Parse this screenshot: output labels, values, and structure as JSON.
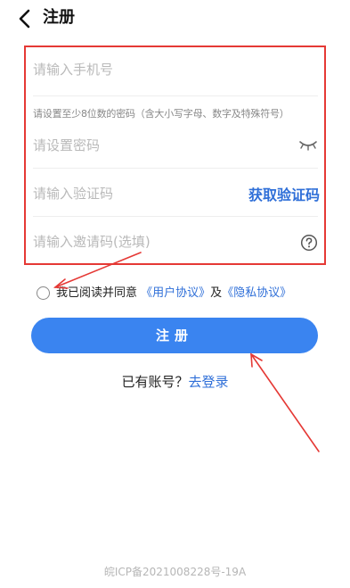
{
  "header": {
    "title": "注册",
    "back_icon": "chevron-left-icon"
  },
  "form": {
    "phone_placeholder": "请输入手机号",
    "password_hint": "请设置至少8位数的密码（含大小写字母、数字及特殊符号）",
    "password_placeholder": "请设置密码",
    "password_eye_icon": "eye-closed-icon",
    "code_placeholder": "请输入验证码",
    "get_code_label": "获取验证码",
    "invite_placeholder": "请输入邀请码(选填)",
    "invite_help_icon": "question-circle-icon"
  },
  "agreement": {
    "text": "我已阅读并同意",
    "user_agreement": "《用户协议》",
    "and": "及",
    "privacy_agreement": "《隐私协议》",
    "checked": false
  },
  "register_button": "注册",
  "login": {
    "prompt": "已有账号？",
    "link": "去登录"
  },
  "footer": "皖ICP备2021008228号-19A",
  "annotation_color": "#e53935",
  "accent_color": "#3a84f0"
}
